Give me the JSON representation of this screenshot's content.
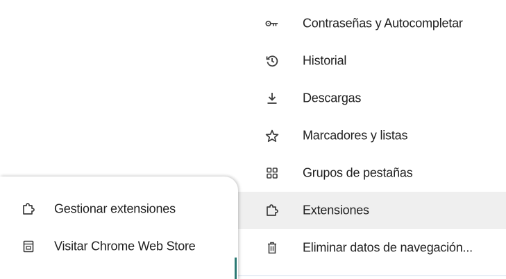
{
  "main_menu": {
    "items": [
      {
        "label": "Contraseñas y Autocompletar",
        "icon": "key-icon"
      },
      {
        "label": "Historial",
        "icon": "history-icon"
      },
      {
        "label": "Descargas",
        "icon": "download-icon"
      },
      {
        "label": "Marcadores y listas",
        "icon": "star-icon"
      },
      {
        "label": "Grupos de pestañas",
        "icon": "tab-groups-icon"
      },
      {
        "label": "Extensiones",
        "icon": "puzzle-icon",
        "highlighted": true
      },
      {
        "label": "Eliminar datos de navegación...",
        "icon": "trash-icon"
      }
    ]
  },
  "extensions_submenu": {
    "items": [
      {
        "label": "Gestionar extensiones",
        "icon": "puzzle-icon"
      },
      {
        "label": "Visitar Chrome Web Store",
        "icon": "web-store-icon"
      }
    ]
  },
  "colors": {
    "text": "#1f1f1f",
    "highlight_bg": "#efefef",
    "icon": "#3c3c3c",
    "submenu_edge_accent": "#2c7a74"
  }
}
